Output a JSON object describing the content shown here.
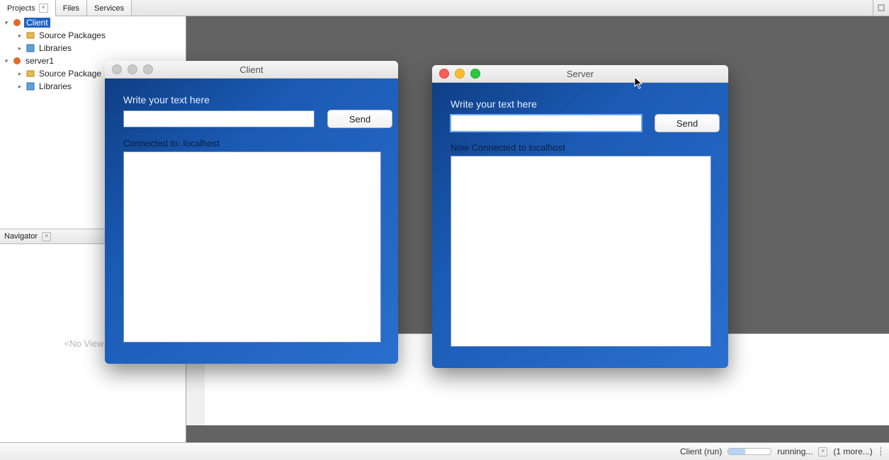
{
  "ide": {
    "tabs": {
      "projects": "Projects",
      "files": "Files",
      "services": "Services"
    },
    "tree": {
      "client": "Client",
      "client_src": "Source Packages",
      "client_lib": "Libraries",
      "server": "server1",
      "server_src": "Source Package",
      "server_lib": "Libraries"
    },
    "navigator_tab": "Navigator",
    "navigator_empty": "<No View Ava",
    "status": {
      "task": "Client (run)",
      "state": "running...",
      "more": "(1 more...)"
    }
  },
  "win_client": {
    "title": "Client",
    "prompt": "Write your text here",
    "send": "Send",
    "status": "Connected to: localhost"
  },
  "win_server": {
    "title": "Server",
    "prompt": "Write your text here",
    "send": "Send",
    "status": "Now Connected to localhost"
  }
}
